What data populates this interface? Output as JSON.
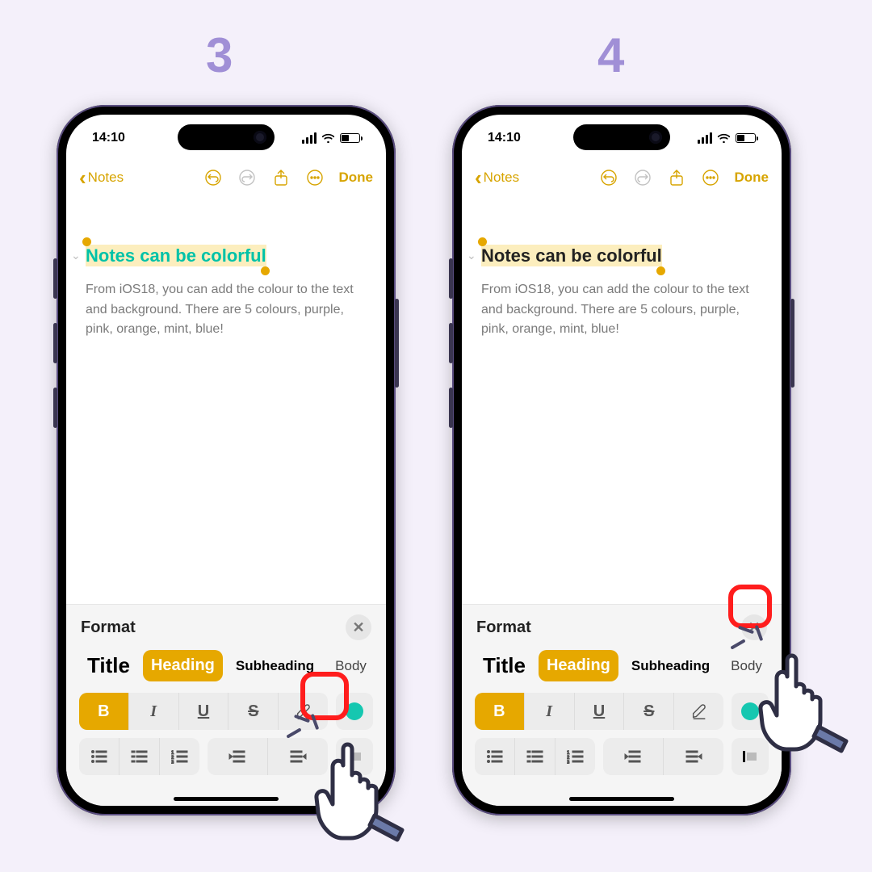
{
  "steps": {
    "left": "3",
    "right": "4"
  },
  "status": {
    "time": "14:10"
  },
  "toolbar": {
    "back_label": "Notes",
    "done_label": "Done"
  },
  "note": {
    "title": "Notes can be colorful",
    "body": "From iOS18, you can add the colour to the text and background. There are 5 colours, purple, pink, orange, mint, blue!"
  },
  "format": {
    "panel_label": "Format",
    "styles": {
      "title": "Title",
      "heading": "Heading",
      "subheading": "Subheading",
      "body": "Body"
    },
    "bius": {
      "b": "B",
      "i": "I",
      "u": "U",
      "s": "S"
    },
    "color_dot": "#15c7b0"
  }
}
